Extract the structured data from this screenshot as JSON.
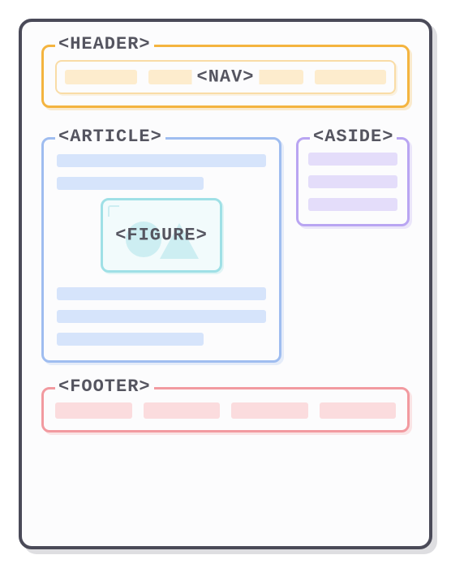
{
  "header": {
    "label": "<HEADER>",
    "nav": {
      "label": "<NAV>"
    }
  },
  "article": {
    "label": "<ARTICLE>",
    "figure": {
      "label": "<FIGURE>"
    }
  },
  "aside": {
    "label": "<ASIDE>"
  },
  "footer": {
    "label": "<FOOTER>"
  }
}
